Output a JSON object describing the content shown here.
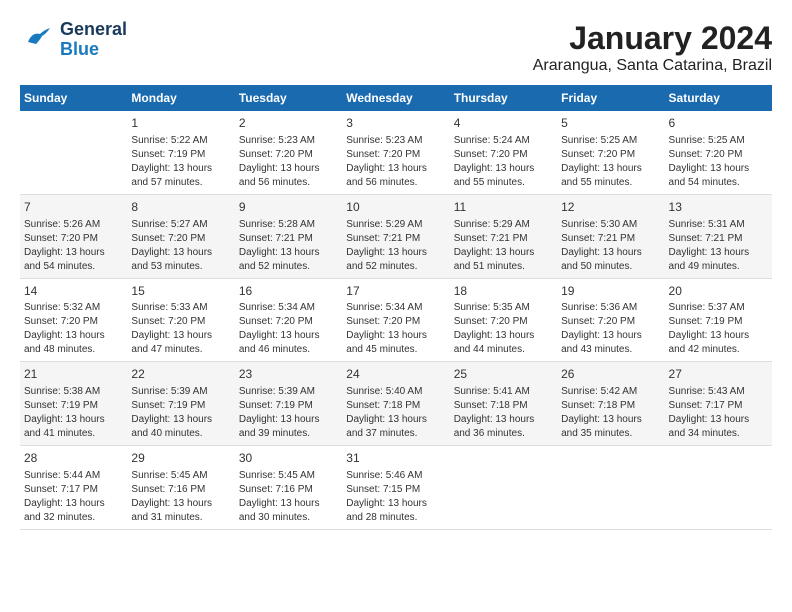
{
  "header": {
    "logo_line1": "General",
    "logo_line2": "Blue",
    "title": "January 2024",
    "subtitle": "Ararangua, Santa Catarina, Brazil"
  },
  "days_of_week": [
    "Sunday",
    "Monday",
    "Tuesday",
    "Wednesday",
    "Thursday",
    "Friday",
    "Saturday"
  ],
  "weeks": [
    [
      {
        "day": "",
        "info": ""
      },
      {
        "day": "1",
        "info": "Sunrise: 5:22 AM\nSunset: 7:19 PM\nDaylight: 13 hours\nand 57 minutes."
      },
      {
        "day": "2",
        "info": "Sunrise: 5:23 AM\nSunset: 7:20 PM\nDaylight: 13 hours\nand 56 minutes."
      },
      {
        "day": "3",
        "info": "Sunrise: 5:23 AM\nSunset: 7:20 PM\nDaylight: 13 hours\nand 56 minutes."
      },
      {
        "day": "4",
        "info": "Sunrise: 5:24 AM\nSunset: 7:20 PM\nDaylight: 13 hours\nand 55 minutes."
      },
      {
        "day": "5",
        "info": "Sunrise: 5:25 AM\nSunset: 7:20 PM\nDaylight: 13 hours\nand 55 minutes."
      },
      {
        "day": "6",
        "info": "Sunrise: 5:25 AM\nSunset: 7:20 PM\nDaylight: 13 hours\nand 54 minutes."
      }
    ],
    [
      {
        "day": "7",
        "info": "Sunrise: 5:26 AM\nSunset: 7:20 PM\nDaylight: 13 hours\nand 54 minutes."
      },
      {
        "day": "8",
        "info": "Sunrise: 5:27 AM\nSunset: 7:20 PM\nDaylight: 13 hours\nand 53 minutes."
      },
      {
        "day": "9",
        "info": "Sunrise: 5:28 AM\nSunset: 7:21 PM\nDaylight: 13 hours\nand 52 minutes."
      },
      {
        "day": "10",
        "info": "Sunrise: 5:29 AM\nSunset: 7:21 PM\nDaylight: 13 hours\nand 52 minutes."
      },
      {
        "day": "11",
        "info": "Sunrise: 5:29 AM\nSunset: 7:21 PM\nDaylight: 13 hours\nand 51 minutes."
      },
      {
        "day": "12",
        "info": "Sunrise: 5:30 AM\nSunset: 7:21 PM\nDaylight: 13 hours\nand 50 minutes."
      },
      {
        "day": "13",
        "info": "Sunrise: 5:31 AM\nSunset: 7:21 PM\nDaylight: 13 hours\nand 49 minutes."
      }
    ],
    [
      {
        "day": "14",
        "info": "Sunrise: 5:32 AM\nSunset: 7:20 PM\nDaylight: 13 hours\nand 48 minutes."
      },
      {
        "day": "15",
        "info": "Sunrise: 5:33 AM\nSunset: 7:20 PM\nDaylight: 13 hours\nand 47 minutes."
      },
      {
        "day": "16",
        "info": "Sunrise: 5:34 AM\nSunset: 7:20 PM\nDaylight: 13 hours\nand 46 minutes."
      },
      {
        "day": "17",
        "info": "Sunrise: 5:34 AM\nSunset: 7:20 PM\nDaylight: 13 hours\nand 45 minutes."
      },
      {
        "day": "18",
        "info": "Sunrise: 5:35 AM\nSunset: 7:20 PM\nDaylight: 13 hours\nand 44 minutes."
      },
      {
        "day": "19",
        "info": "Sunrise: 5:36 AM\nSunset: 7:20 PM\nDaylight: 13 hours\nand 43 minutes."
      },
      {
        "day": "20",
        "info": "Sunrise: 5:37 AM\nSunset: 7:19 PM\nDaylight: 13 hours\nand 42 minutes."
      }
    ],
    [
      {
        "day": "21",
        "info": "Sunrise: 5:38 AM\nSunset: 7:19 PM\nDaylight: 13 hours\nand 41 minutes."
      },
      {
        "day": "22",
        "info": "Sunrise: 5:39 AM\nSunset: 7:19 PM\nDaylight: 13 hours\nand 40 minutes."
      },
      {
        "day": "23",
        "info": "Sunrise: 5:39 AM\nSunset: 7:19 PM\nDaylight: 13 hours\nand 39 minutes."
      },
      {
        "day": "24",
        "info": "Sunrise: 5:40 AM\nSunset: 7:18 PM\nDaylight: 13 hours\nand 37 minutes."
      },
      {
        "day": "25",
        "info": "Sunrise: 5:41 AM\nSunset: 7:18 PM\nDaylight: 13 hours\nand 36 minutes."
      },
      {
        "day": "26",
        "info": "Sunrise: 5:42 AM\nSunset: 7:18 PM\nDaylight: 13 hours\nand 35 minutes."
      },
      {
        "day": "27",
        "info": "Sunrise: 5:43 AM\nSunset: 7:17 PM\nDaylight: 13 hours\nand 34 minutes."
      }
    ],
    [
      {
        "day": "28",
        "info": "Sunrise: 5:44 AM\nSunset: 7:17 PM\nDaylight: 13 hours\nand 32 minutes."
      },
      {
        "day": "29",
        "info": "Sunrise: 5:45 AM\nSunset: 7:16 PM\nDaylight: 13 hours\nand 31 minutes."
      },
      {
        "day": "30",
        "info": "Sunrise: 5:45 AM\nSunset: 7:16 PM\nDaylight: 13 hours\nand 30 minutes."
      },
      {
        "day": "31",
        "info": "Sunrise: 5:46 AM\nSunset: 7:15 PM\nDaylight: 13 hours\nand 28 minutes."
      },
      {
        "day": "",
        "info": ""
      },
      {
        "day": "",
        "info": ""
      },
      {
        "day": "",
        "info": ""
      }
    ]
  ]
}
